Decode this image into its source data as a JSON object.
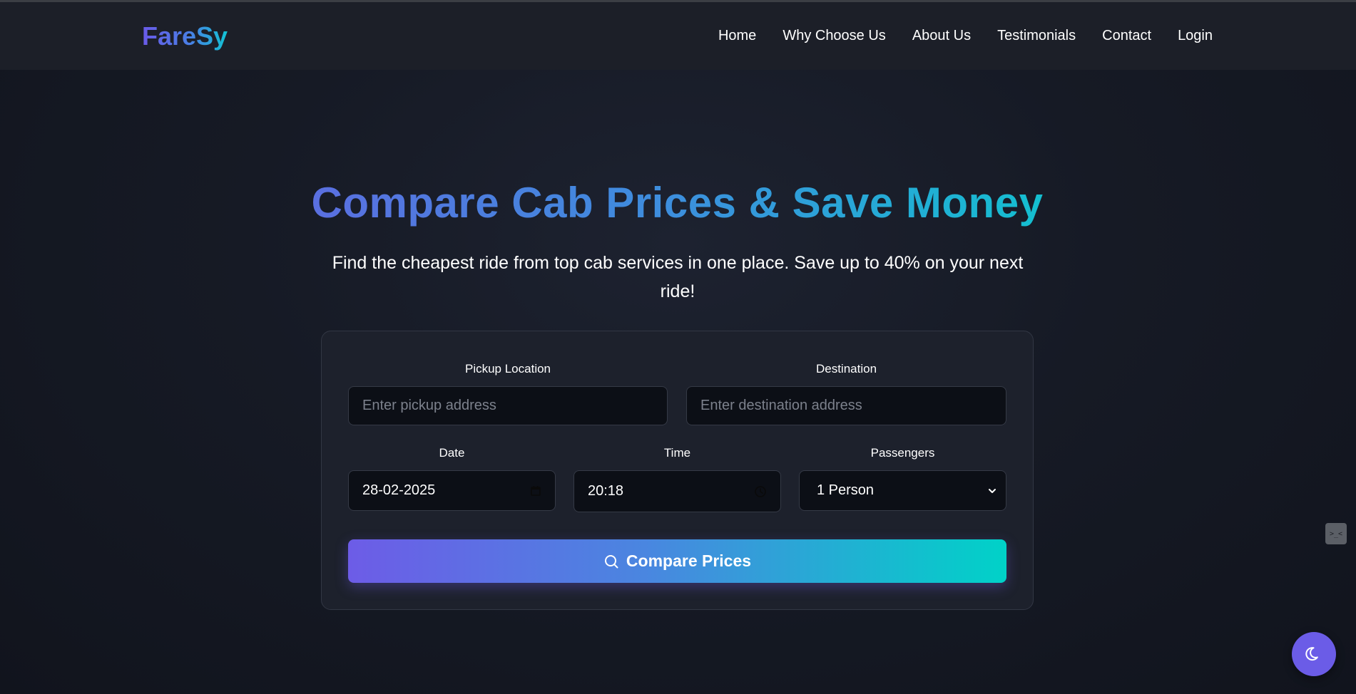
{
  "brand": {
    "name": "FareSy"
  },
  "nav": {
    "items": [
      "Home",
      "Why Choose Us",
      "About Us",
      "Testimonials",
      "Contact",
      "Login"
    ]
  },
  "hero": {
    "title": "Compare Cab Prices & Save Money",
    "subtitle": "Find the cheapest ride from top cab services in one place. Save up to 40% on your next ride!"
  },
  "form": {
    "pickup": {
      "label": "Pickup Location",
      "placeholder": "Enter pickup address"
    },
    "destination": {
      "label": "Destination",
      "placeholder": "Enter destination address"
    },
    "date": {
      "label": "Date",
      "value": "28-02-2025",
      "icon": "calendar-icon"
    },
    "time": {
      "label": "Time",
      "value": "20:18",
      "icon": "clock-icon"
    },
    "passengers": {
      "label": "Passengers",
      "value": "1 Person",
      "icon": "chevron-down-icon"
    },
    "submit": {
      "label": "Compare Prices",
      "icon": "search-icon"
    }
  },
  "widgets": {
    "side_widget": {
      "text": ">_<"
    },
    "theme_toggle": {
      "icon": "moon-icon"
    }
  },
  "colors": {
    "background": "#161a25",
    "navbar": "#1c1f28",
    "card": "#1d212c",
    "input": "#0c0f16",
    "accent_start": "#6d5ce7",
    "accent_end": "#00d2c8"
  }
}
